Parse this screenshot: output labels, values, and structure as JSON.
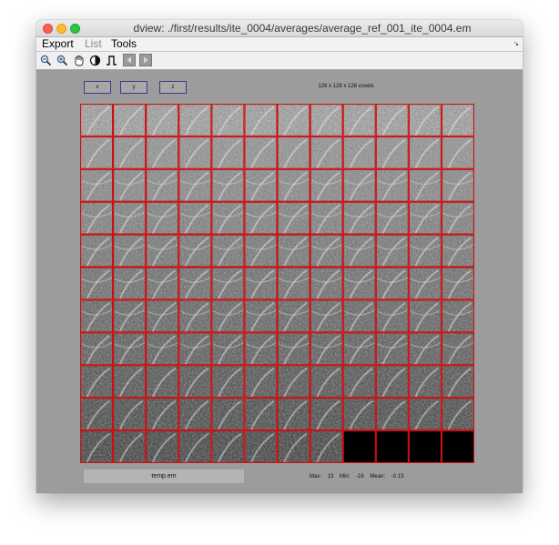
{
  "window": {
    "title": "dview: ./first/results/ite_0004/averages/average_ref_001_ite_0004.em"
  },
  "menu": {
    "items": [
      {
        "label": "Export",
        "enabled": true
      },
      {
        "label": "List",
        "enabled": false
      },
      {
        "label": "Tools",
        "enabled": true
      }
    ]
  },
  "toolbar": {
    "icons": [
      "zoom-out-icon",
      "zoom-in-icon",
      "pan-hand-icon",
      "contrast-icon",
      "threshold-icon",
      "previous-icon",
      "next-icon"
    ]
  },
  "axes": {
    "buttons": [
      {
        "label": "x"
      },
      {
        "label": "y"
      },
      {
        "label": "z"
      }
    ]
  },
  "volume": {
    "dimensions": "128 x 128 x 128 voxels"
  },
  "montage": {
    "rows": 11,
    "cols": 12,
    "filled_slices": 128,
    "border_color": "#cc1111",
    "empty_color": "#000000"
  },
  "footer": {
    "filename": "temp.em",
    "max_label": "Max:",
    "max_value": "13",
    "min_label": "Min:",
    "min_value": "-16",
    "mean_label": "Mean:",
    "mean_value": "-0.13"
  }
}
